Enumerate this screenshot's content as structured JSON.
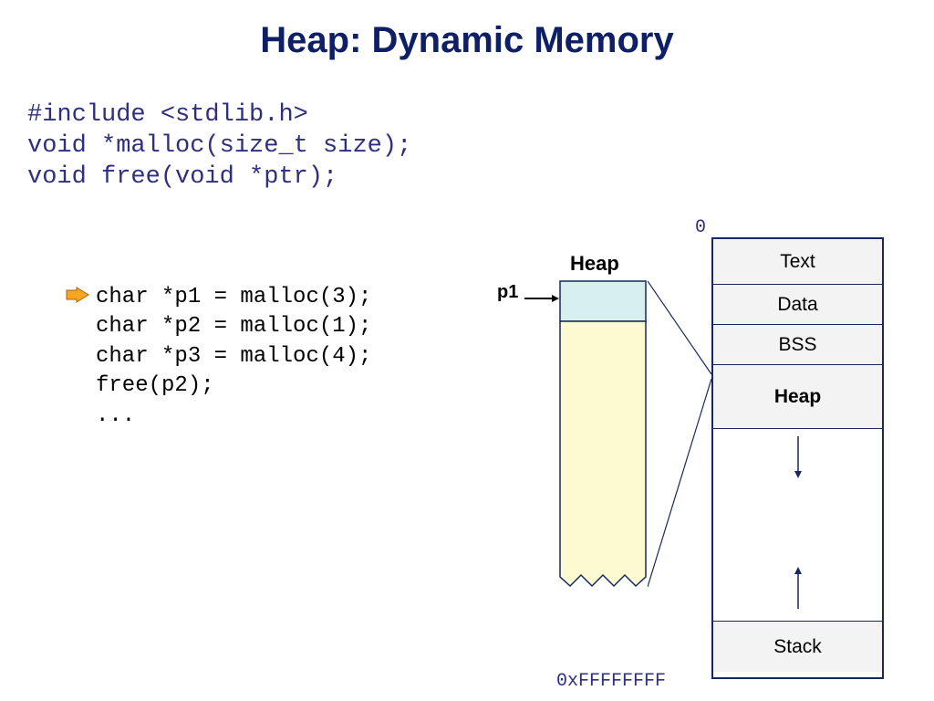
{
  "title": "Heap: Dynamic Memory",
  "code_top": "#include <stdlib.h>\nvoid *malloc(size_t size);\nvoid free(void *ptr);",
  "code_mid": "char *p1 = malloc(3);\nchar *p2 = malloc(1);\nchar *p3 = malloc(4);\nfree(p2);\n...",
  "heap_label": "Heap",
  "p1_label": "p1",
  "addr_top": "0",
  "addr_bot": "0xFFFFFFFF",
  "segments": {
    "text": "Text",
    "data": "Data",
    "bss": "BSS",
    "heap": "Heap",
    "stack": "Stack"
  }
}
